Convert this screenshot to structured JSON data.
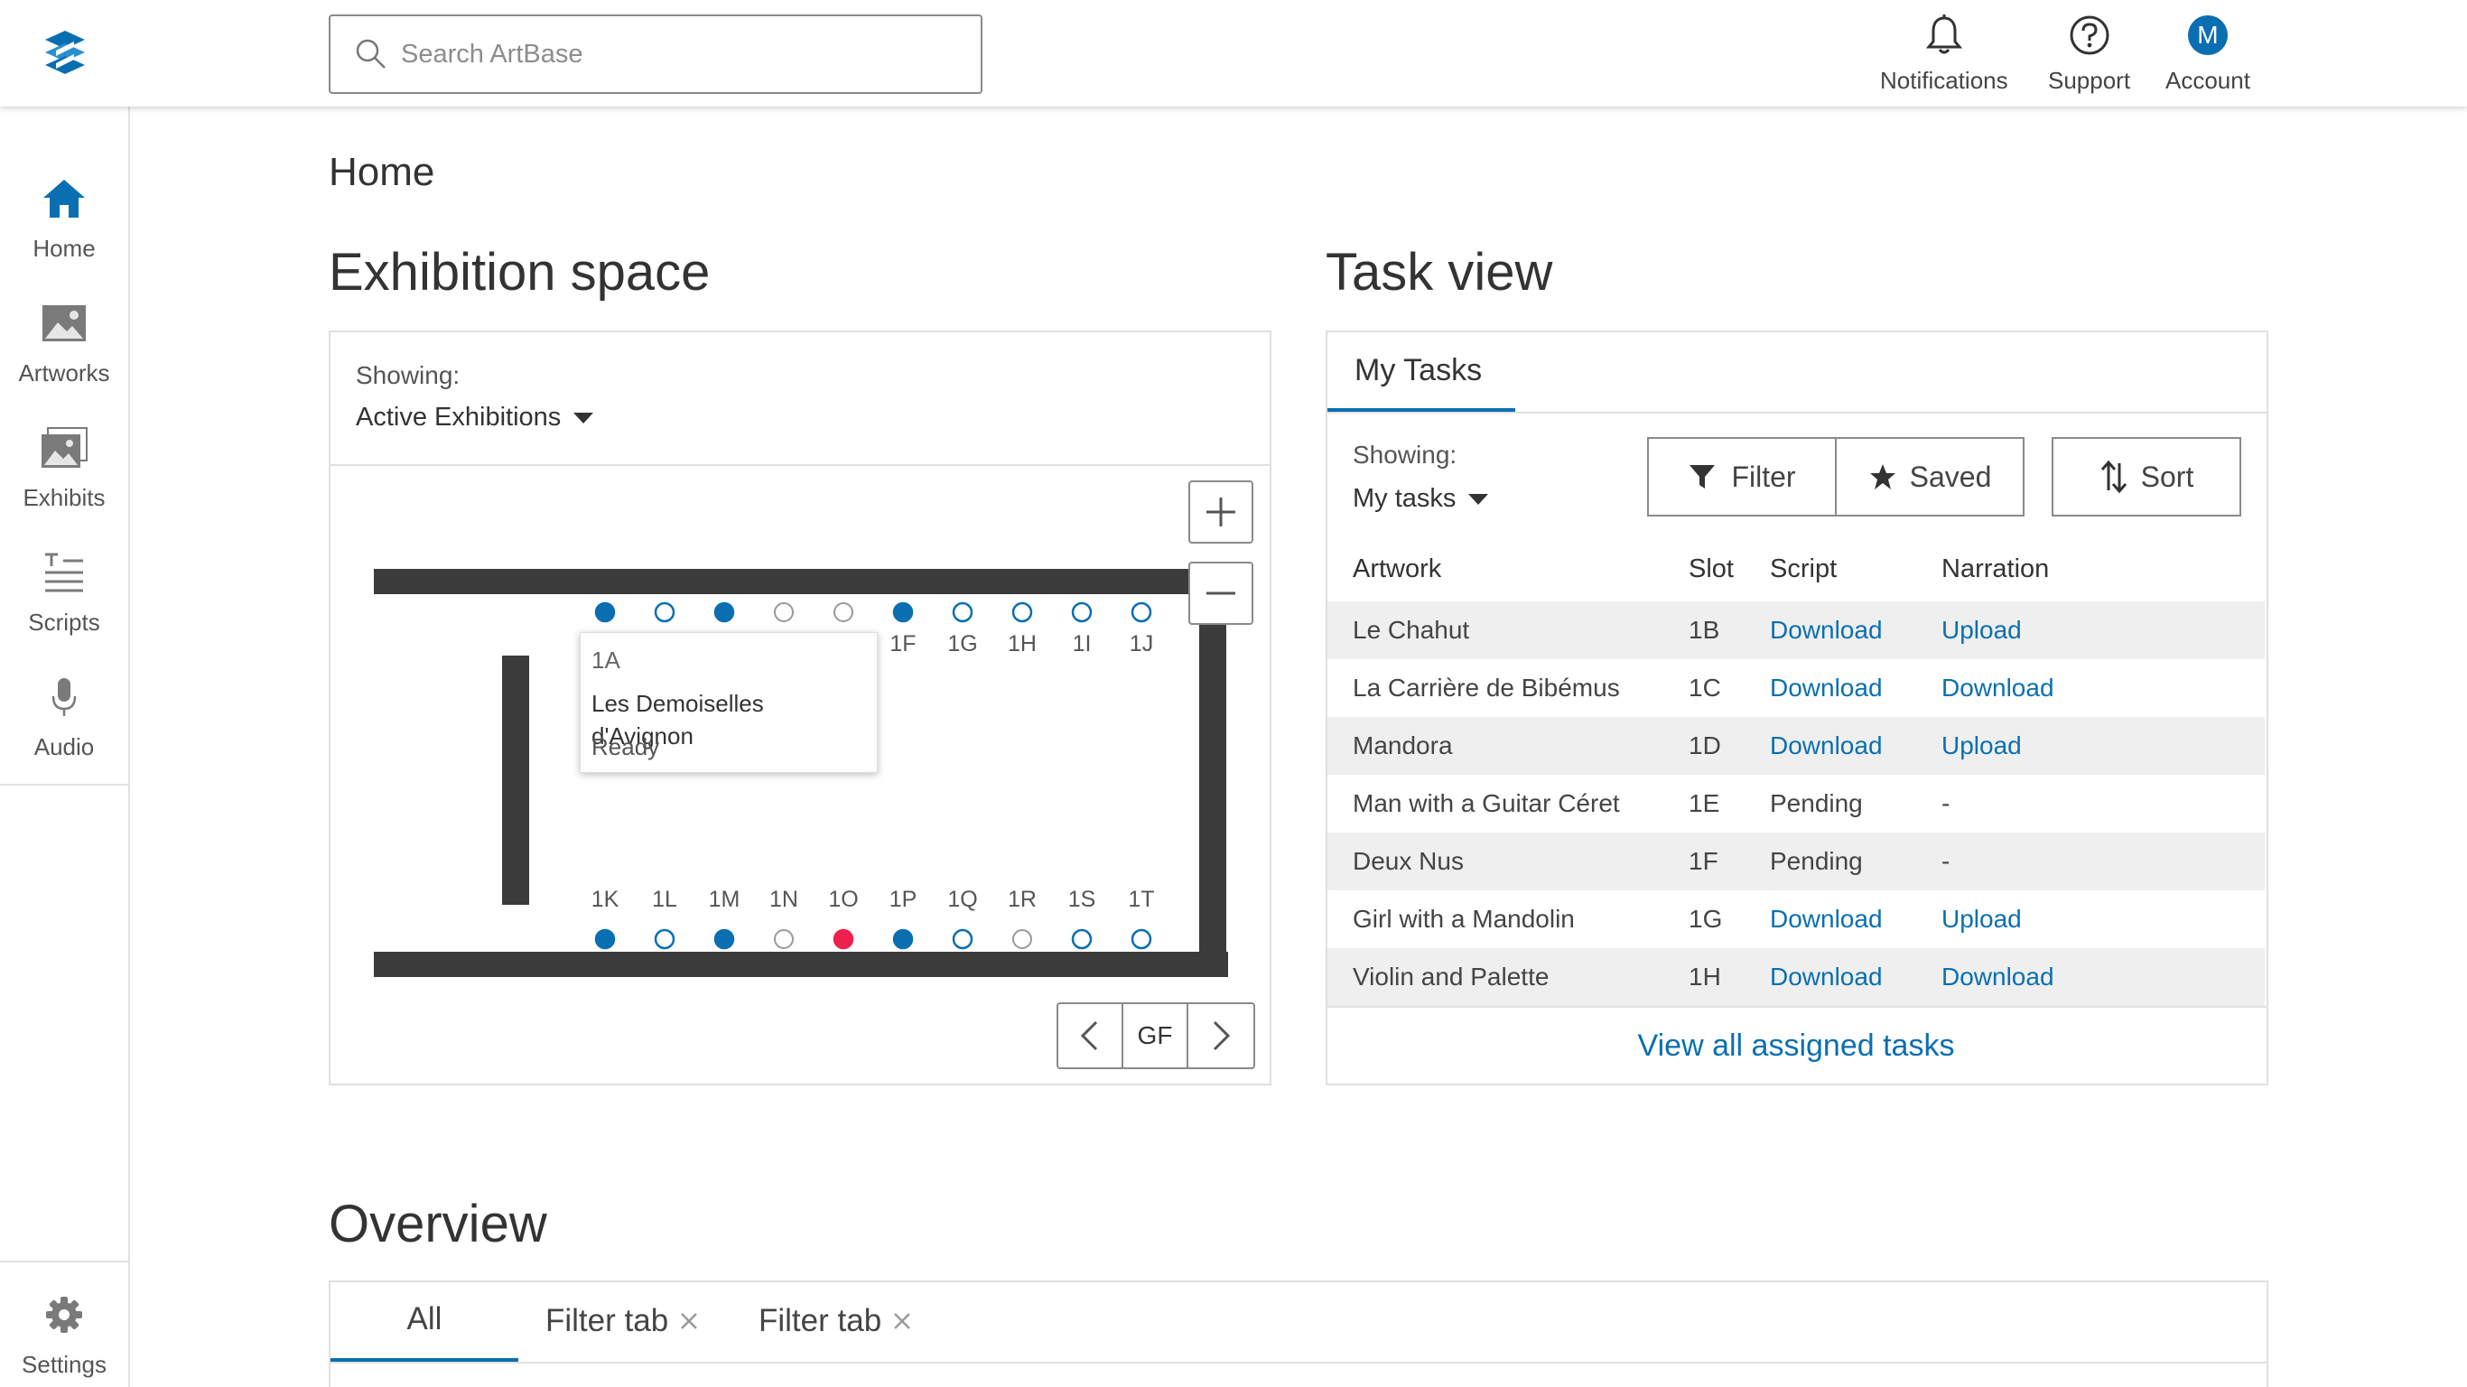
{
  "app": {
    "search_placeholder": "Search ArtBase"
  },
  "topnav": {
    "notifications": "Notifications",
    "support": "Support",
    "account": "Account",
    "avatar_initial": "M"
  },
  "sidebar": {
    "items": [
      {
        "label": "Home",
        "icon": "home-icon",
        "active": true
      },
      {
        "label": "Artworks",
        "icon": "image-icon"
      },
      {
        "label": "Exhibits",
        "icon": "gallery-icon"
      },
      {
        "label": "Scripts",
        "icon": "text-icon"
      },
      {
        "label": "Audio",
        "icon": "microphone-icon"
      }
    ],
    "settings": "Settings"
  },
  "page_title": "Home",
  "exhibition": {
    "title": "Exhibition space",
    "showing_label": "Showing:",
    "showing_value": "Active Exhibitions",
    "floor": "GF",
    "top_slots": [
      {
        "label": "1A",
        "state": "filled"
      },
      {
        "label": "1B",
        "state": "open"
      },
      {
        "label": "1C",
        "state": "filled"
      },
      {
        "label": "1D",
        "state": "grey"
      },
      {
        "label": "1E",
        "state": "grey"
      },
      {
        "label": "1F",
        "state": "filled"
      },
      {
        "label": "1G",
        "state": "open"
      },
      {
        "label": "1H",
        "state": "open"
      },
      {
        "label": "1I",
        "state": "open"
      },
      {
        "label": "1J",
        "state": "open"
      }
    ],
    "bottom_slots": [
      {
        "label": "1K",
        "state": "filled"
      },
      {
        "label": "1L",
        "state": "open"
      },
      {
        "label": "1M",
        "state": "filled"
      },
      {
        "label": "1N",
        "state": "grey"
      },
      {
        "label": "1O",
        "state": "alert"
      },
      {
        "label": "1P",
        "state": "filled"
      },
      {
        "label": "1Q",
        "state": "open"
      },
      {
        "label": "1R",
        "state": "grey"
      },
      {
        "label": "1S",
        "state": "open"
      },
      {
        "label": "1T",
        "state": "open"
      }
    ],
    "tooltip": {
      "slot": "1A",
      "artwork": "Les Demoiselles d'Avignon",
      "status": "Ready"
    },
    "colors": {
      "filled": "#0a6fb1",
      "alert": "#f0204e",
      "grey": "#999999",
      "wall": "#3b3b3b"
    }
  },
  "tasks": {
    "title": "Task view",
    "tab": "My Tasks",
    "showing_label": "Showing:",
    "showing_value": "My tasks",
    "filter": "Filter",
    "saved": "Saved",
    "sort": "Sort",
    "headers": {
      "artwork": "Artwork",
      "slot": "Slot",
      "script": "Script",
      "narration": "Narration"
    },
    "rows": [
      {
        "artwork": "Le Chahut",
        "slot": "1B",
        "script": "Download",
        "narration": "Upload"
      },
      {
        "artwork": "La Carrière de Bibémus",
        "slot": "1C",
        "script": "Download",
        "narration": "Download"
      },
      {
        "artwork": "Mandora",
        "slot": "1D",
        "script": "Download",
        "narration": "Upload"
      },
      {
        "artwork": "Man with a Guitar Céret",
        "slot": "1E",
        "script": "Pending",
        "narration": "-"
      },
      {
        "artwork": "Deux Nus",
        "slot": "1F",
        "script": "Pending",
        "narration": "-"
      },
      {
        "artwork": "Girl with a Mandolin",
        "slot": "1G",
        "script": "Download",
        "narration": "Upload"
      },
      {
        "artwork": "Violin and Palette",
        "slot": "1H",
        "script": "Download",
        "narration": "Download"
      }
    ],
    "view_all": "View all assigned tasks"
  },
  "overview": {
    "title": "Overview",
    "tabs": [
      "All",
      "Filter tab",
      "Filter tab"
    ]
  }
}
